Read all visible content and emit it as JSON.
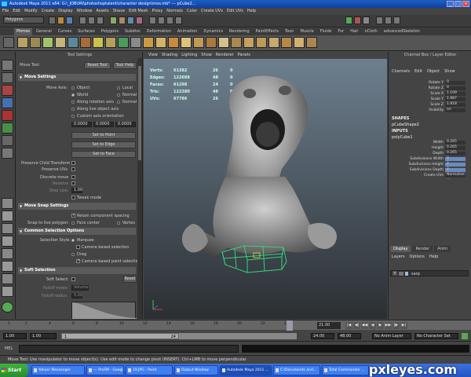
{
  "window": {
    "title": "Autodesk Maya 2011 x64: G:\\_JOBURI\\photoshoptalent\\character design\\mos.mb*  ---  pCube2...",
    "buttons": [
      "_",
      "□",
      "×"
    ]
  },
  "menubar": [
    "File",
    "Edit",
    "Modify",
    "Create",
    "Display",
    "Window",
    "Assets",
    "Shave",
    "Edit Mesh",
    "Proxy",
    "Normals",
    "Color",
    "Create UVs",
    "Edit UVs",
    "Help"
  ],
  "statusline": {
    "mode": "Polygons"
  },
  "shelf": {
    "tabs": [
      "Phrnos",
      "General",
      "Curves",
      "Surfaces",
      "Polygons",
      "Subdivs",
      "Deformation",
      "Animation",
      "Dynamics",
      "Rendering",
      "PaintEffects",
      "Toon",
      "Muscle",
      "Fluids",
      "Fur",
      "Hair",
      "nCloth",
      "advancedSkeleton"
    ],
    "active_tab": 0
  },
  "tool_settings": {
    "panel_title": "Tool Settings",
    "tool_name": "Move Tool",
    "reset_button": "Reset Tool",
    "help_button": "Tool Help",
    "move_settings": {
      "header": "Move Settings",
      "move_axis_label": "Move Axis:",
      "opts": [
        "Object",
        "Local",
        "World",
        "Normal",
        "Along rotation axis",
        "Normal",
        "Along live object axis",
        "Custom axis orientation"
      ],
      "fields": [
        "0.0000",
        "0.0000",
        "0.0000"
      ],
      "set_to_point": "Set to Point",
      "set_to_edge": "Set to Edge",
      "set_to_face": "Set to Face",
      "preserve_child": "Preserve Child Transform",
      "preserve_uvs": "Preserve UVs",
      "discrete_move": "Discrete move",
      "relative": "Relative",
      "step_size": "Step size:",
      "step_value": "1.00",
      "tweak_mode": "Tweak mode"
    },
    "move_snap": {
      "header": "Move Snap Settings",
      "retain_spacing": "Retain component spacing",
      "snap_live": "Snap to live polygon:",
      "face_center": "Face center",
      "vertex": "Vertex"
    },
    "common_selection": {
      "header": "Common Selection Options",
      "style_label": "Selection Style:",
      "marquee": "Marquee",
      "camera_paint": "Camera based selection",
      "drag": "Drag",
      "camera_based_paint": "Camera based paint selection"
    },
    "soft_selection": {
      "header": "Soft Selection",
      "soft_select": "Soft Select:",
      "reset": "Reset",
      "falloff_mode": "Falloff mode:",
      "falloff_mode_value": "Volume",
      "falloff_radius": "Falloff radius:",
      "falloff_radius_value": "5.00"
    }
  },
  "viewport": {
    "menu": [
      "View",
      "Shading",
      "Lighting",
      "Show",
      "Renderer",
      "Panels"
    ],
    "hud": [
      {
        "k": "Verts:",
        "v1": "61382",
        "v2": "26",
        "v3": "0"
      },
      {
        "k": "Edges:",
        "v1": "122688",
        "v2": "48",
        "v3": "0"
      },
      {
        "k": "Faces:",
        "v1": "61298",
        "v2": "24",
        "v3": "0"
      },
      {
        "k": "Tris:",
        "v1": "122380",
        "v2": "48",
        "v3": "0"
      },
      {
        "k": "UVs:",
        "v1": "67786",
        "v2": "26",
        "v3": "0"
      }
    ]
  },
  "channel_box": {
    "title": "Channel Box / Layer Editor",
    "menu": [
      "Channels",
      "Edit",
      "Object",
      "Show"
    ],
    "attrs": [
      {
        "n": "Rotate Y",
        "v": "0"
      },
      {
        "n": "Rotate Z",
        "v": "0"
      },
      {
        "n": "Scale X",
        "v": "1.109"
      },
      {
        "n": "Scale Y",
        "v": "1.987"
      },
      {
        "n": "Scale Z",
        "v": "1.818"
      },
      {
        "n": "Visibility",
        "v": "on"
      }
    ],
    "shapes_header": "SHAPES",
    "shape_name": "pCubeShape2",
    "inputs_header": "INPUTS",
    "input_name": "polyCube1",
    "input_attrs": [
      {
        "n": "Width",
        "v": "0.265",
        "hl": false
      },
      {
        "n": "Height",
        "v": "0.265",
        "hl": false
      },
      {
        "n": "Depth",
        "v": "0.265",
        "hl": false
      },
      {
        "n": "Subdivisions Width",
        "v": "2",
        "hl": true
      },
      {
        "n": "Subdivisions Height",
        "v": "2",
        "hl": true
      },
      {
        "n": "Subdivisions Depth",
        "v": "2",
        "hl": true
      },
      {
        "n": "Create UVs",
        "v": "Normalize ...",
        "hl": false
      }
    ],
    "tabs": [
      "Display",
      "Render",
      "Anim"
    ],
    "layer_menu": [
      "Layers",
      "Options",
      "Help"
    ],
    "layer": {
      "v": "V",
      "name": "sarp"
    }
  },
  "timeline": {
    "ticks": [
      "1",
      "2",
      "4",
      "6",
      "8",
      "10",
      "12",
      "14",
      "16",
      "18",
      "20",
      "22",
      "24"
    ],
    "current": "21.00"
  },
  "range": {
    "start": "1.00",
    "start2": "1.00",
    "slider_a": "1",
    "slider_b": "24",
    "end": "24.00",
    "end2": "48.00",
    "anim_layer": "No Anim Layer",
    "character": "No Character Set"
  },
  "cmdline": {
    "label": "MEL"
  },
  "helpline": "Move Tool: Use manipulator to move object(s). Use edit mode to change pivot (INSERT). Ctrl+LMB to move perpendicular.",
  "taskbar": {
    "start": "Start",
    "tasks": [
      "Yahoo! Messenger",
      "--- ProFM - Google ...",
      "19.JPG - Paint",
      "Output Window",
      "Autodesk Maya 2011 ...",
      "C:\\Documents and...",
      "Total Commander ..."
    ],
    "active_task": 4
  },
  "watermark": "pxleyes.com",
  "colors": {
    "accent": "#1d5fc5",
    "viewport_top": "#6d7f8e",
    "viewport_bottom": "#2b2f33",
    "wire": "#37d27a"
  }
}
